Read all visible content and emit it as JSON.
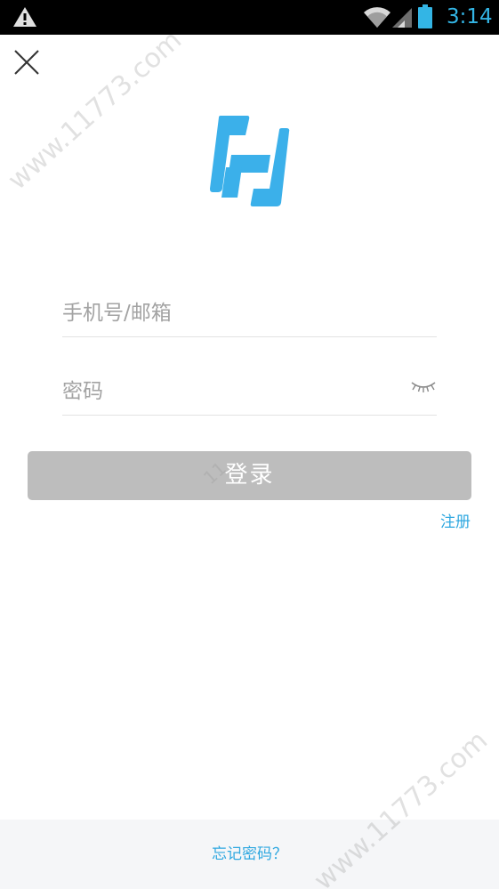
{
  "status_bar": {
    "time": "3:14",
    "icons": [
      "warning-icon",
      "wifi-icon",
      "signal-icon",
      "battery-icon"
    ],
    "accent_color": "#33b5e5"
  },
  "close_icon": "close-icon",
  "logo": {
    "icon": "app-logo-icon",
    "color": "#3bb0ea"
  },
  "form": {
    "phone_placeholder": "手机号/邮箱",
    "password_placeholder": "密码",
    "eye_icon": "eye-closed-icon",
    "login_label": "登录",
    "register_label": "注册"
  },
  "footer": {
    "forgot_label": "忘记密码？"
  },
  "watermark": {
    "text": "www.11773.com",
    "fragment": "11"
  },
  "colors": {
    "link": "#2fa8e0",
    "button_disabled": "#bdbdbd",
    "footer_bg": "#f5f6f8"
  }
}
